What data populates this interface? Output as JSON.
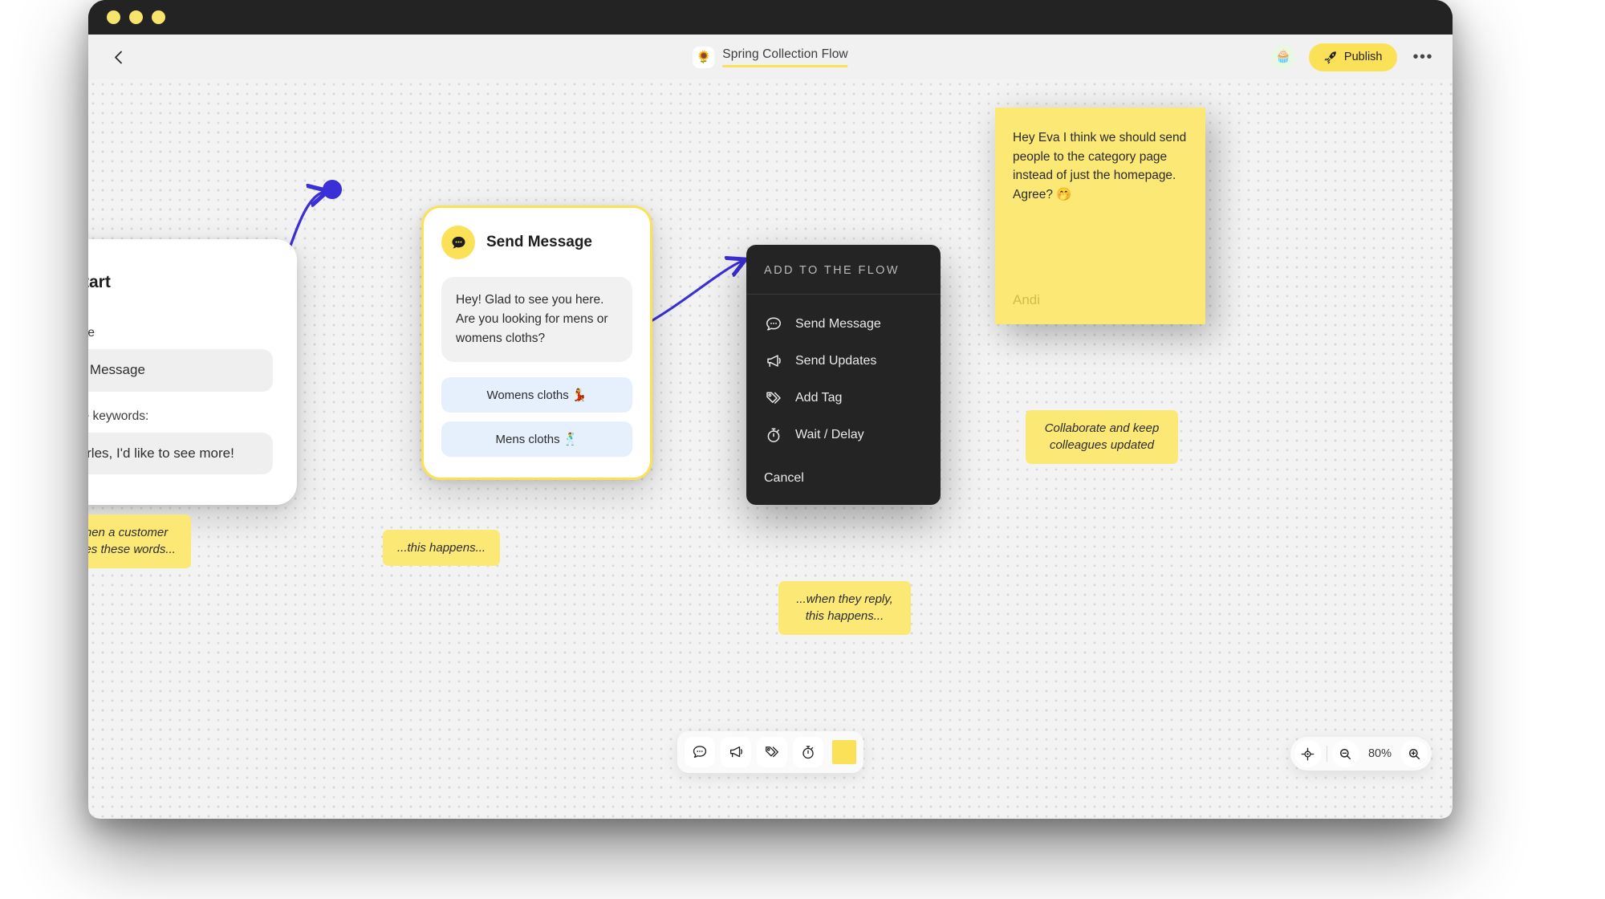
{
  "window": {
    "traffic_dots": 3
  },
  "header": {
    "back_icon": "chevron-left-icon",
    "doc_emoji": "🌻",
    "doc_title": "Spring Collection Flow",
    "avatar_emoji": "🧁",
    "publish_label": "Publish",
    "publish_icon": "rocket-icon",
    "publish_color": "#fbe158",
    "more_label": "•••"
  },
  "canvas": {
    "zoom_level": "80%",
    "accent_blue": "#3b2fd6",
    "accent_yellow": "#fbe158"
  },
  "start_node": {
    "icon": "rocket-icon",
    "title": "Start",
    "event_label": "Event/Source",
    "event_value": "Matched Message",
    "keywords_label": "Any of those keywords:",
    "keywords_value": "Hey Charles, I'd like to see more!"
  },
  "send_node": {
    "icon": "chat-bubble-icon",
    "title": "Send Message",
    "message": "Hey! Glad to see you here. Are you looking for mens or womens cloths?",
    "quick_replies": [
      {
        "label": "Womens cloths 💃"
      },
      {
        "label": "Mens cloths 🕺"
      }
    ]
  },
  "add_menu": {
    "header": "ADD TO THE FLOW",
    "items": [
      {
        "label": "Send Message",
        "icon": "chat-bubble-icon"
      },
      {
        "label": "Send Updates",
        "icon": "megaphone-icon"
      },
      {
        "label": "Add Tag",
        "icon": "tag-icon"
      },
      {
        "label": "Wait / Delay",
        "icon": "timer-icon"
      }
    ],
    "cancel_label": "Cancel"
  },
  "sticky_note": {
    "text": "Hey Eva I think we should send people to the category page instead of just the homepage. Agree? 🤭",
    "author": "Andi",
    "color": "#fbe875"
  },
  "callouts": [
    {
      "text": "When a customer writes these words..."
    },
    {
      "text": "...this happens..."
    },
    {
      "text": "...when they reply, this happens..."
    },
    {
      "text": "Collaborate and keep colleagues updated"
    }
  ],
  "toolbar": {
    "items": [
      {
        "icon": "chat-bubble-icon",
        "name": "send-message"
      },
      {
        "icon": "megaphone-icon",
        "name": "send-updates"
      },
      {
        "icon": "tag-icon",
        "name": "add-tag"
      },
      {
        "icon": "timer-icon",
        "name": "wait-delay"
      },
      {
        "icon": "sticky-note-icon",
        "name": "add-note"
      }
    ]
  },
  "zoom_controls": {
    "center_icon": "crosshair-icon",
    "zoom_out_icon": "zoom-out-icon",
    "level": "80%",
    "zoom_in_icon": "zoom-in-icon"
  }
}
